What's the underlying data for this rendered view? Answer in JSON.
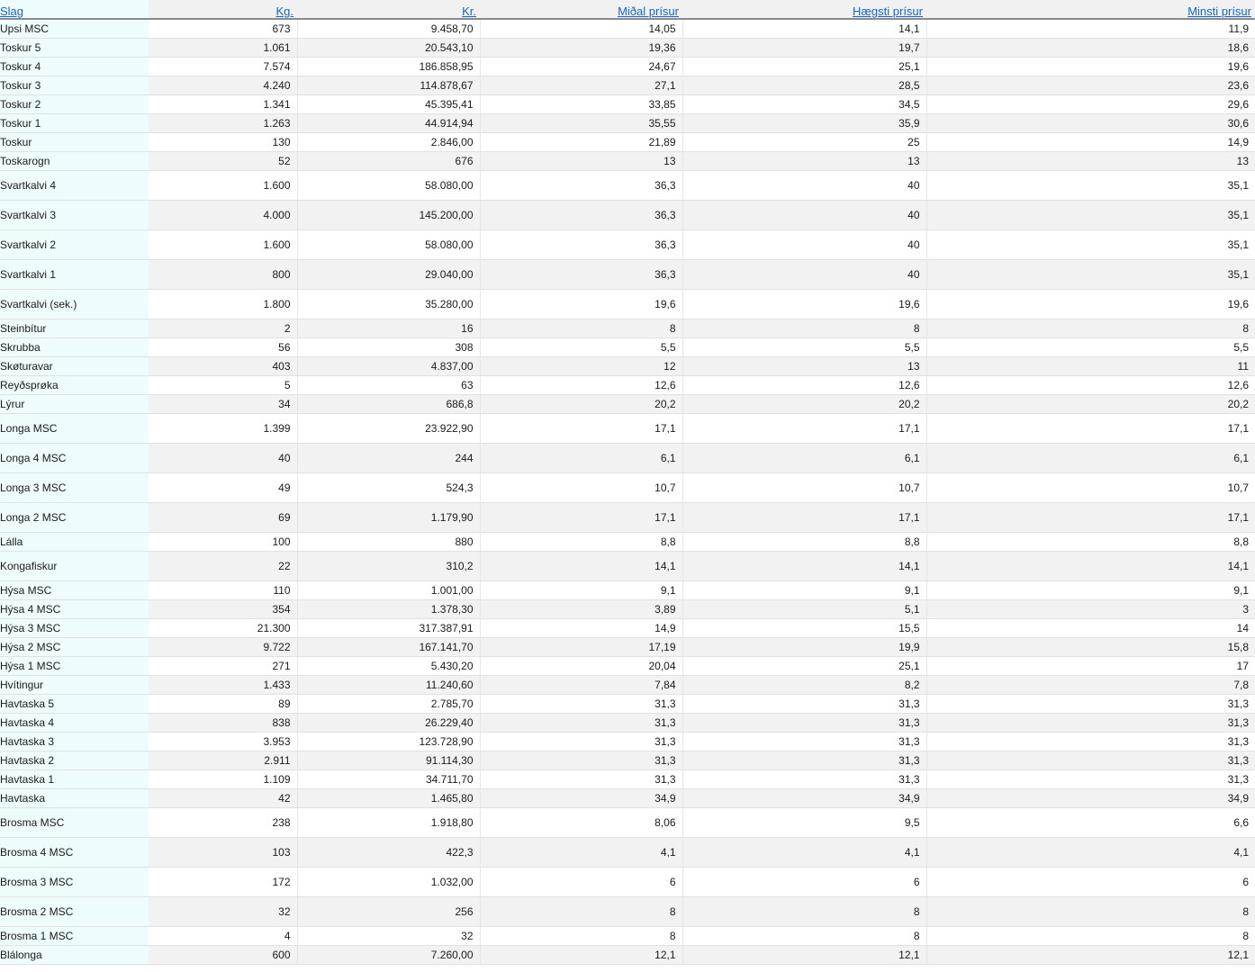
{
  "headers": [
    "Slag",
    "Kg.",
    "Kr.",
    "Miðal prísur",
    "Hægsti prísur",
    "Minsti prísur"
  ],
  "rows": [
    {
      "name": "Upsi MSC",
      "kg": "673",
      "kr": "9.458,70",
      "avg": "14,05",
      "high": "14,1",
      "low": "11,9",
      "h": "n"
    },
    {
      "name": "Toskur 5",
      "kg": "1.061",
      "kr": "20.543,10",
      "avg": "19,36",
      "high": "19,7",
      "low": "18,6",
      "h": "n"
    },
    {
      "name": "Toskur 4",
      "kg": "7.574",
      "kr": "186.858,95",
      "avg": "24,67",
      "high": "25,1",
      "low": "19,6",
      "h": "n"
    },
    {
      "name": "Toskur 3",
      "kg": "4.240",
      "kr": "114.878,67",
      "avg": "27,1",
      "high": "28,5",
      "low": "23,6",
      "h": "n"
    },
    {
      "name": "Toskur 2",
      "kg": "1.341",
      "kr": "45.395,41",
      "avg": "33,85",
      "high": "34,5",
      "low": "29,6",
      "h": "n"
    },
    {
      "name": "Toskur 1",
      "kg": "1.263",
      "kr": "44.914,94",
      "avg": "35,55",
      "high": "35,9",
      "low": "30,6",
      "h": "n"
    },
    {
      "name": "Toskur",
      "kg": "130",
      "kr": "2.846,00",
      "avg": "21,89",
      "high": "25",
      "low": "14,9",
      "h": "n"
    },
    {
      "name": "Toskarogn",
      "kg": "52",
      "kr": "676",
      "avg": "13",
      "high": "13",
      "low": "13",
      "h": "n"
    },
    {
      "name": "Svartkalvi 4",
      "kg": "1.600",
      "kr": "58.080,00",
      "avg": "36,3",
      "high": "40",
      "low": "35,1",
      "h": "t"
    },
    {
      "name": "Svartkalvi 3",
      "kg": "4.000",
      "kr": "145.200,00",
      "avg": "36,3",
      "high": "40",
      "low": "35,1",
      "h": "t"
    },
    {
      "name": "Svartkalvi 2",
      "kg": "1.600",
      "kr": "58.080,00",
      "avg": "36,3",
      "high": "40",
      "low": "35,1",
      "h": "t"
    },
    {
      "name": "Svartkalvi 1",
      "kg": "800",
      "kr": "29.040,00",
      "avg": "36,3",
      "high": "40",
      "low": "35,1",
      "h": "t"
    },
    {
      "name": "Svartkalvi (sek.)",
      "kg": "1.800",
      "kr": "35.280,00",
      "avg": "19,6",
      "high": "19,6",
      "low": "19,6",
      "h": "t"
    },
    {
      "name": "Steinbítur",
      "kg": "2",
      "kr": "16",
      "avg": "8",
      "high": "8",
      "low": "8",
      "h": "n"
    },
    {
      "name": "Skrubba",
      "kg": "56",
      "kr": "308",
      "avg": "5,5",
      "high": "5,5",
      "low": "5,5",
      "h": "n"
    },
    {
      "name": "Skøturavar",
      "kg": "403",
      "kr": "4.837,00",
      "avg": "12",
      "high": "13",
      "low": "11",
      "h": "n"
    },
    {
      "name": "Reyðsprøka",
      "kg": "5",
      "kr": "63",
      "avg": "12,6",
      "high": "12,6",
      "low": "12,6",
      "h": "n"
    },
    {
      "name": "Lýrur",
      "kg": "34",
      "kr": "686,8",
      "avg": "20,2",
      "high": "20,2",
      "low": "20,2",
      "h": "n"
    },
    {
      "name": "Longa MSC",
      "kg": "1.399",
      "kr": "23.922,90",
      "avg": "17,1",
      "high": "17,1",
      "low": "17,1",
      "h": "t"
    },
    {
      "name": "Longa 4 MSC",
      "kg": "40",
      "kr": "244",
      "avg": "6,1",
      "high": "6,1",
      "low": "6,1",
      "h": "t"
    },
    {
      "name": "Longa 3 MSC",
      "kg": "49",
      "kr": "524,3",
      "avg": "10,7",
      "high": "10,7",
      "low": "10,7",
      "h": "t"
    },
    {
      "name": "Longa 2 MSC",
      "kg": "69",
      "kr": "1.179,90",
      "avg": "17,1",
      "high": "17,1",
      "low": "17,1",
      "h": "t"
    },
    {
      "name": "Lálla",
      "kg": "100",
      "kr": "880",
      "avg": "8,8",
      "high": "8,8",
      "low": "8,8",
      "h": "n"
    },
    {
      "name": "Kongafiskur",
      "kg": "22",
      "kr": "310,2",
      "avg": "14,1",
      "high": "14,1",
      "low": "14,1",
      "h": "t"
    },
    {
      "name": "Hýsa MSC",
      "kg": "110",
      "kr": "1.001,00",
      "avg": "9,1",
      "high": "9,1",
      "low": "9,1",
      "h": "n"
    },
    {
      "name": "Hýsa 4 MSC",
      "kg": "354",
      "kr": "1.378,30",
      "avg": "3,89",
      "high": "5,1",
      "low": "3",
      "h": "n"
    },
    {
      "name": "Hýsa 3 MSC",
      "kg": "21.300",
      "kr": "317.387,91",
      "avg": "14,9",
      "high": "15,5",
      "low": "14",
      "h": "n"
    },
    {
      "name": "Hýsa 2 MSC",
      "kg": "9.722",
      "kr": "167.141,70",
      "avg": "17,19",
      "high": "19,9",
      "low": "15,8",
      "h": "n"
    },
    {
      "name": "Hýsa 1 MSC",
      "kg": "271",
      "kr": "5.430,20",
      "avg": "20,04",
      "high": "25,1",
      "low": "17",
      "h": "n"
    },
    {
      "name": "Hvítingur",
      "kg": "1.433",
      "kr": "11.240,60",
      "avg": "7,84",
      "high": "8,2",
      "low": "7,8",
      "h": "n"
    },
    {
      "name": "Havtaska 5",
      "kg": "89",
      "kr": "2.785,70",
      "avg": "31,3",
      "high": "31,3",
      "low": "31,3",
      "h": "n"
    },
    {
      "name": "Havtaska 4",
      "kg": "838",
      "kr": "26.229,40",
      "avg": "31,3",
      "high": "31,3",
      "low": "31,3",
      "h": "n"
    },
    {
      "name": "Havtaska 3",
      "kg": "3.953",
      "kr": "123.728,90",
      "avg": "31,3",
      "high": "31,3",
      "low": "31,3",
      "h": "n"
    },
    {
      "name": "Havtaska 2",
      "kg": "2.911",
      "kr": "91.114,30",
      "avg": "31,3",
      "high": "31,3",
      "low": "31,3",
      "h": "n"
    },
    {
      "name": "Havtaska 1",
      "kg": "1.109",
      "kr": "34.711,70",
      "avg": "31,3",
      "high": "31,3",
      "low": "31,3",
      "h": "n"
    },
    {
      "name": "Havtaska",
      "kg": "42",
      "kr": "1.465,80",
      "avg": "34,9",
      "high": "34,9",
      "low": "34,9",
      "h": "n"
    },
    {
      "name": "Brosma MSC",
      "kg": "238",
      "kr": "1.918,80",
      "avg": "8,06",
      "high": "9,5",
      "low": "6,6",
      "h": "t"
    },
    {
      "name": "Brosma 4 MSC",
      "kg": "103",
      "kr": "422,3",
      "avg": "4,1",
      "high": "4,1",
      "low": "4,1",
      "h": "t"
    },
    {
      "name": "Brosma 3 MSC",
      "kg": "172",
      "kr": "1.032,00",
      "avg": "6",
      "high": "6",
      "low": "6",
      "h": "t"
    },
    {
      "name": "Brosma 2 MSC",
      "kg": "32",
      "kr": "256",
      "avg": "8",
      "high": "8",
      "low": "8",
      "h": "t"
    },
    {
      "name": "Brosma 1 MSC",
      "kg": "4",
      "kr": "32",
      "avg": "8",
      "high": "8",
      "low": "8",
      "h": "n"
    },
    {
      "name": "Blálonga",
      "kg": "600",
      "kr": "7.260,00",
      "avg": "12,1",
      "high": "12,1",
      "low": "12,1",
      "h": "n"
    }
  ]
}
